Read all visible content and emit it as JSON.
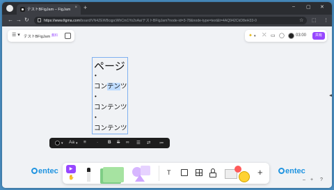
{
  "browser": {
    "tab_title": "テストBFigJam – FigJam",
    "tab_close": "×",
    "new_tab": "+",
    "window_controls": [
      "–",
      "▢",
      "✕"
    ],
    "nav": {
      "back": "←",
      "forward": "→",
      "reload": "↻"
    },
    "url_host": "https://www.figma.com",
    "url_path": "/board/VN4ZEW8cqpcWhCm1Yo2xAa/テストBFigJam?node-id=3-78&node-type=text&t=4AQ942CkD8eH33-0",
    "toolbar_icons": [
      "☆",
      "⬚",
      "⋮"
    ]
  },
  "file_panel": {
    "menu_label": "☰ ▾",
    "file_name": "テストBFigJam",
    "plan_badge": "無料"
  },
  "right_panel": {
    "timer": "03:00",
    "share_label": "共有",
    "chevron": "▾"
  },
  "text_block": {
    "heading": "ページ",
    "bullet": "•",
    "items": [
      {
        "before": "コン",
        "selected": "テン",
        "after": "ツ"
      },
      {
        "before": "コンテンツ",
        "selected": "",
        "after": ""
      },
      {
        "before": "コンテンツ",
        "selected": "",
        "after": ""
      }
    ]
  },
  "format_bar": {
    "color_chevron": "▾",
    "font_size_label": "Aa",
    "font_chevron": "▾",
    "align_icon": "≡",
    "bold": "B",
    "strike": "S",
    "link_icon": "🔗",
    "bullets_icon": "☰",
    "list_icon": "≔",
    "share_icon": "⇄",
    "more_icon": "⋯"
  },
  "bottom_toolbar": {
    "cursor": "▶",
    "hand": "✋",
    "text_tool": "T",
    "plus": "+"
  },
  "logos": {
    "left": "entec",
    "right": "entec"
  },
  "zoom": {
    "minus": "–",
    "plus": "+",
    "help": "?"
  },
  "side_handle": "◂▸"
}
